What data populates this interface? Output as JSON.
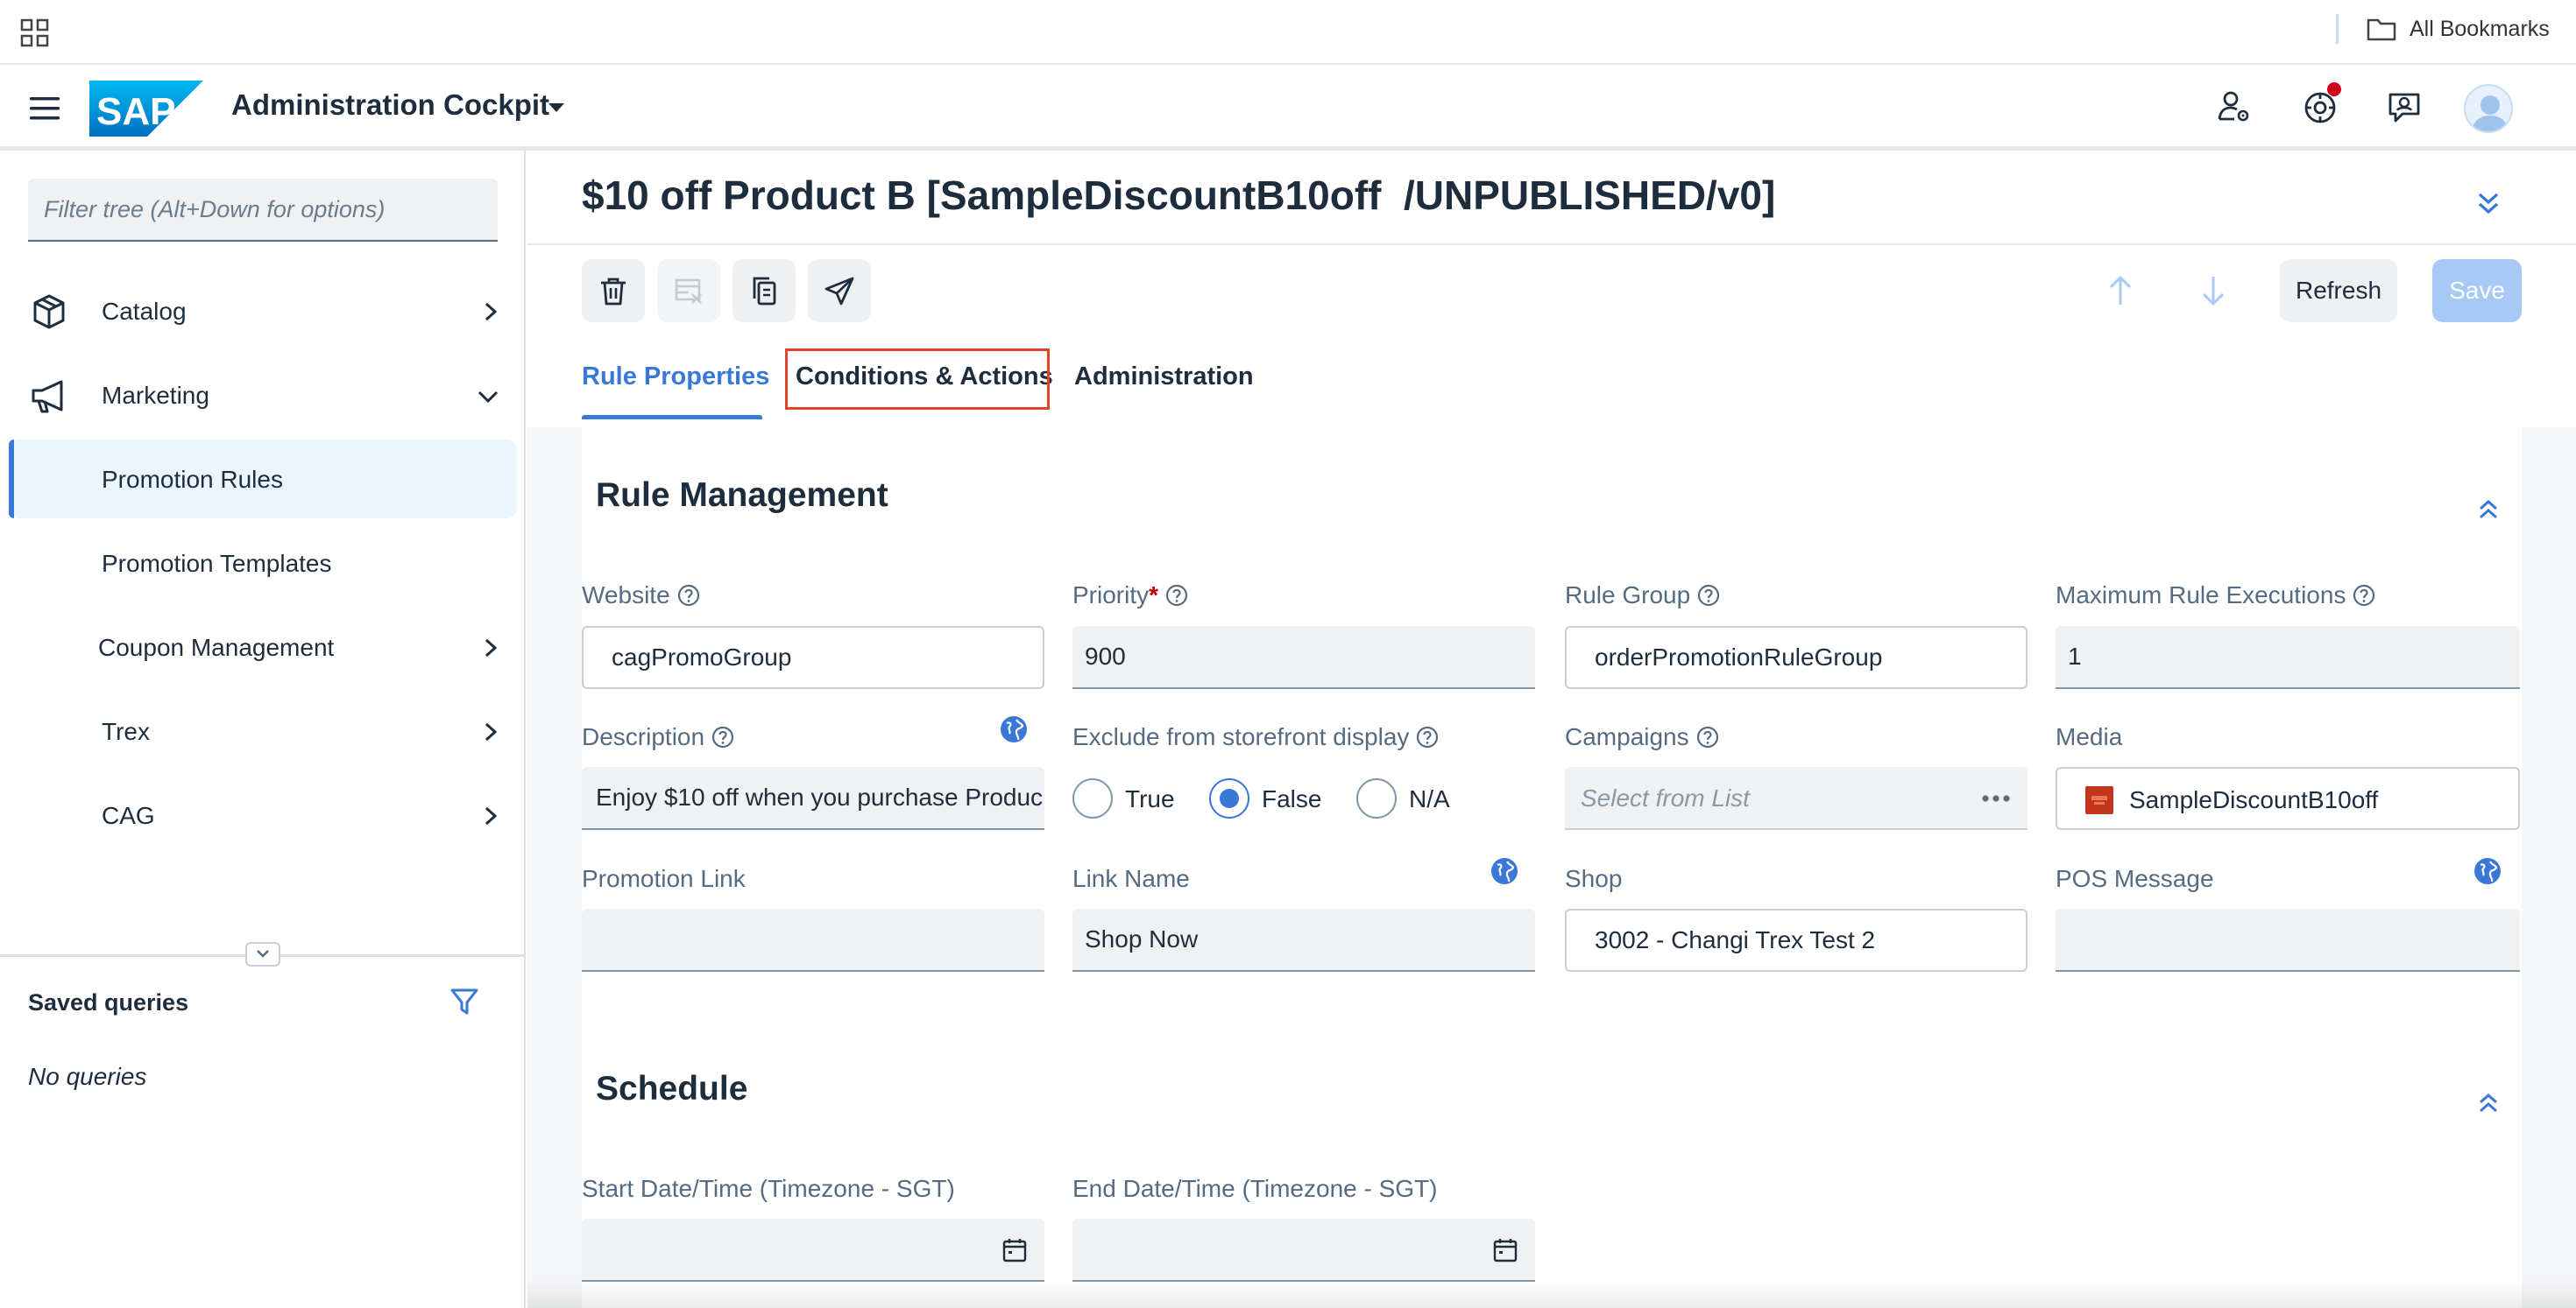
{
  "browser": {
    "bookmarks_label": "All Bookmarks"
  },
  "shell": {
    "app_title": "Administration Cockpit",
    "logo_text": "SAP"
  },
  "sidebar": {
    "filter_placeholder": "Filter tree (Alt+Down for options)",
    "items": [
      {
        "label": "Catalog"
      },
      {
        "label": "Marketing"
      },
      {
        "label": "Promotion Rules"
      },
      {
        "label": "Promotion Templates"
      },
      {
        "label": "Coupon Management"
      },
      {
        "label": "Trex"
      },
      {
        "label": "CAG"
      }
    ],
    "saved_queries_title": "Saved queries",
    "no_queries": "No queries"
  },
  "main": {
    "object_title": "$10 off Product B [SampleDiscountB10off  /UNPUBLISHED/v0]",
    "refresh_label": "Refresh",
    "save_label": "Save",
    "tabs": [
      {
        "label": "Rule Properties"
      },
      {
        "label": "Conditions & Actions"
      },
      {
        "label": "Administration"
      }
    ]
  },
  "rule_management": {
    "title": "Rule Management",
    "website_label": "Website",
    "website_value": "cagPromoGroup",
    "priority_label": "Priority",
    "priority_required": "*",
    "priority_value": "900",
    "rule_group_label": "Rule Group",
    "rule_group_value": "orderPromotionRuleGroup",
    "max_exec_label": "Maximum Rule Executions",
    "max_exec_value": "1",
    "description_label": "Description",
    "description_value": "Enjoy $10 off when you purchase Produc",
    "exclude_label": "Exclude from storefront display",
    "exclude_options": [
      "True",
      "False",
      "N/A"
    ],
    "exclude_selected": "False",
    "campaigns_label": "Campaigns",
    "campaigns_placeholder": "Select from List",
    "media_label": "Media",
    "media_value": "SampleDiscountB10off",
    "promo_link_label": "Promotion Link",
    "promo_link_value": "",
    "link_name_label": "Link Name",
    "link_name_value": "Shop Now",
    "shop_label": "Shop",
    "shop_value": "3002 - Changi Trex Test 2",
    "pos_message_label": "POS Message",
    "pos_message_value": ""
  },
  "schedule": {
    "title": "Schedule",
    "start_label": "Start Date/Time (Timezone - SGT)",
    "end_label": "End Date/Time (Timezone - SGT)"
  },
  "colors": {
    "accent": "#3a78d8",
    "highlight_border": "#e0452b",
    "text": "#1d2d3e",
    "label": "#556b82"
  }
}
